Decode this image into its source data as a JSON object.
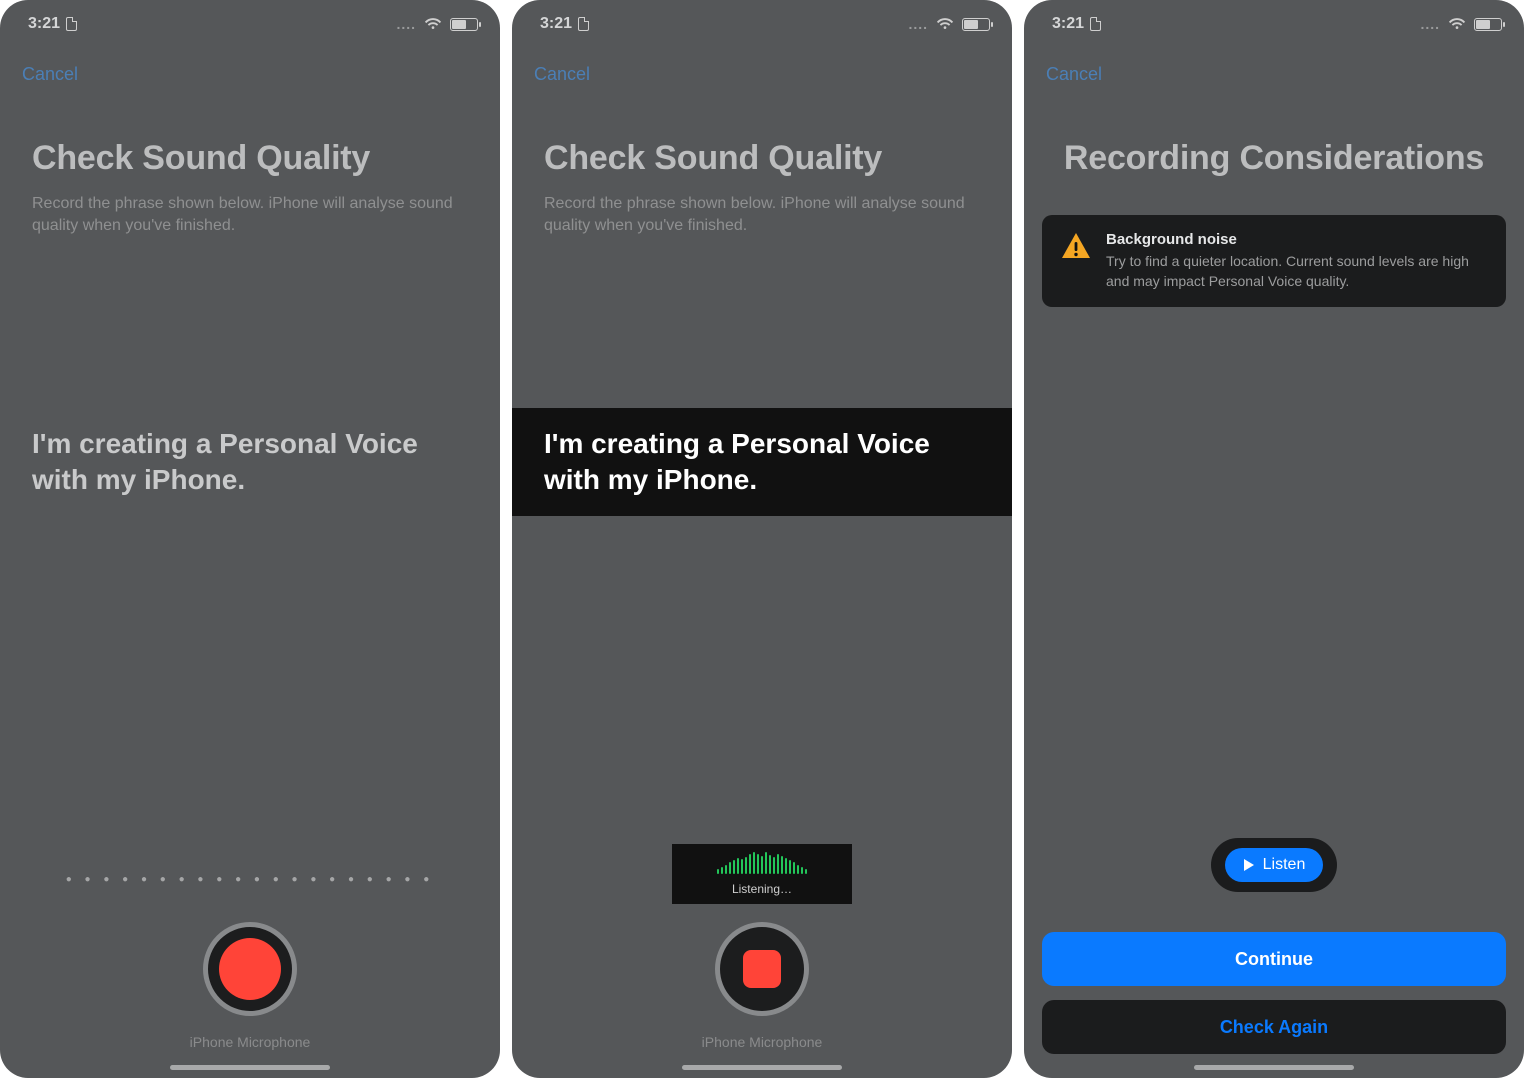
{
  "statusbar": {
    "time": "3:21"
  },
  "nav": {
    "cancel": "Cancel"
  },
  "panel1": {
    "title": "Check Sound Quality",
    "subtitle": "Record the phrase shown below. iPhone will analyse sound quality when you've finished.",
    "phrase": "I'm creating a Personal Voice with my iPhone.",
    "micLabel": "iPhone Microphone"
  },
  "panel2": {
    "title": "Check Sound Quality",
    "subtitle": "Record the phrase shown below. iPhone will analyse sound quality when you've finished.",
    "phrase": "I'm creating a Personal Voice with my iPhone.",
    "listening": "Listening…",
    "micLabel": "iPhone Microphone"
  },
  "panel3": {
    "title": "Recording Considerations",
    "warnTitle": "Background noise",
    "warnBody": "Try to find a quieter location. Current sound levels are high and may impact Personal Voice quality.",
    "listen": "Listen",
    "continue": "Continue",
    "checkAgain": "Check Again"
  }
}
